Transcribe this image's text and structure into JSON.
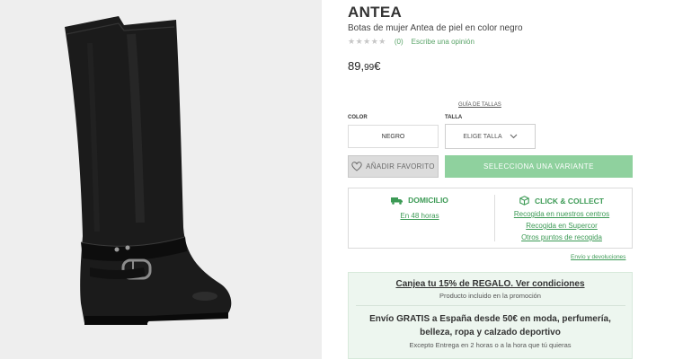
{
  "product": {
    "title": "ANTEA",
    "subtitle": "Botas de mujer Antea de piel en color negro",
    "rating": {
      "stars": "★★★★★",
      "count": "(0)",
      "write_review": "Escribe una opinión"
    },
    "price": {
      "integer": "89,",
      "decimal": "99",
      "currency": "€"
    }
  },
  "options": {
    "size_guide": "GUÍA DE TALLAS",
    "color_label": "COLOR",
    "color_value": "NEGRO",
    "size_label": "TALLA",
    "size_placeholder": "ELIGE TALLA"
  },
  "actions": {
    "favorite": "AÑADIR FAVORITO",
    "select_variant": "SELECCIONA UNA VARIANTE"
  },
  "delivery": {
    "home": {
      "title": "DOMICILIO",
      "detail": "En 48 horas"
    },
    "collect": {
      "title": "CLICK & COLLECT",
      "options": [
        "Recogida en nuestros centros",
        "Recogida en Supercor",
        "Otros puntos de recogida"
      ]
    },
    "returns_link": "Envío y devoluciones"
  },
  "promo": {
    "headline": "Canjea tu 15% de REGALO. Ver condiciones",
    "headline_sub": "Producto incluido en la promoción",
    "shipping": "Envío GRATIS a España desde 50€ en moda, perfumería, belleza, ropa y calzado deportivo",
    "shipping_sub": "Excepto Entrega en 2 horas o a la hora que tú quieras"
  },
  "colors": {
    "accent_green": "#3c9a55",
    "variant_button": "#8fd19e",
    "promo_background": "#edf6ef",
    "image_background": "#eeeeee"
  },
  "icons": {
    "rating": "star-icon",
    "size_dropdown": "chevron-down-icon",
    "favorite": "heart-icon",
    "home_delivery": "truck-icon",
    "click_collect": "box-icon"
  }
}
